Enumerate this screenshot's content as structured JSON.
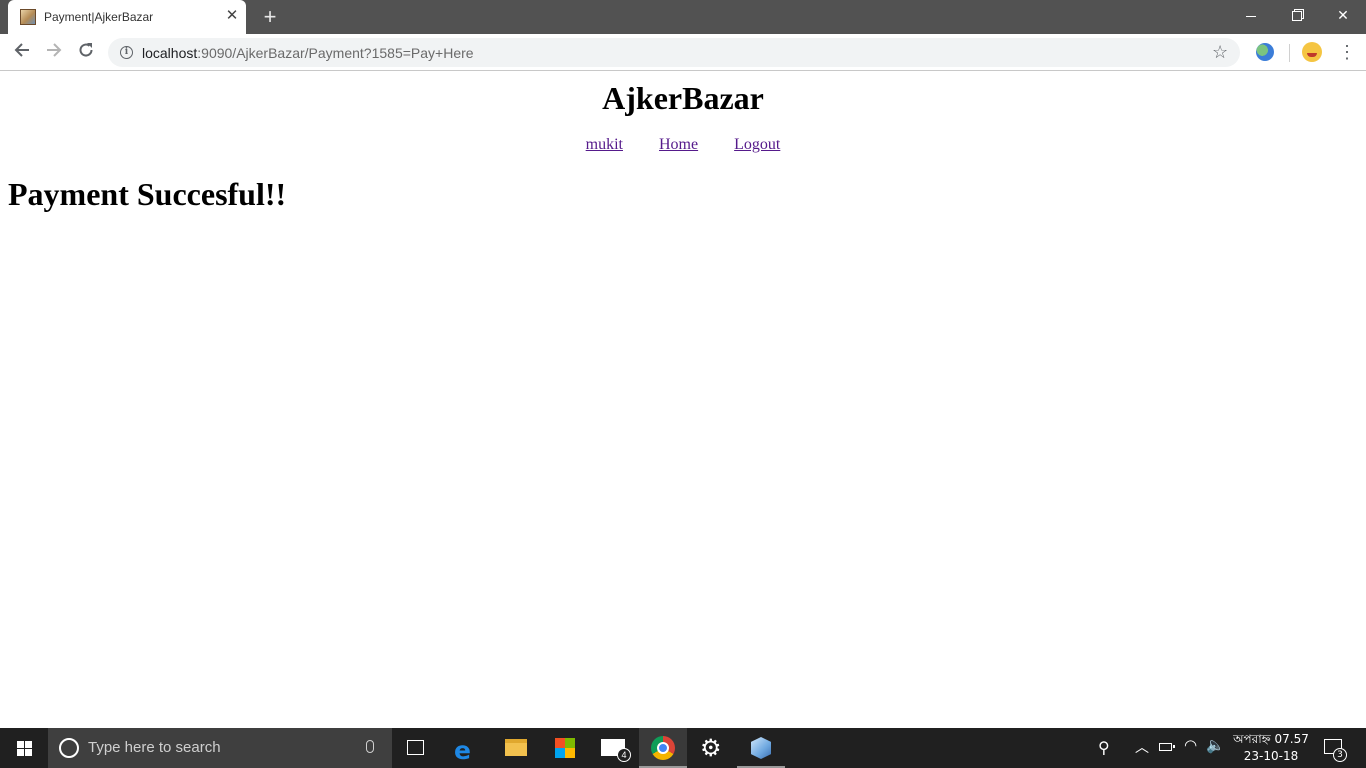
{
  "browser": {
    "tab_title": "Payment|AjkerBazar",
    "tab_close": "✕",
    "new_tab": "+",
    "url_host": "localhost",
    "url_rest": ":9090/AjkerBazar/Payment?1585=Pay+Here",
    "icons": [
      "favicon",
      "close-icon",
      "plus-icon",
      "back-icon",
      "forward-icon",
      "reload-icon",
      "info-icon",
      "star-icon",
      "extension-globe-icon",
      "avatar",
      "menu-icon"
    ]
  },
  "window_controls": {
    "close": "✕"
  },
  "page": {
    "site_title": "AjkerBazar",
    "nav": {
      "user": "mukit",
      "home": "Home",
      "logout": "Logout"
    },
    "message": "Payment Succesful!!"
  },
  "taskbar": {
    "search_placeholder": "Type here to search",
    "mail_badge": "4",
    "clock_time": "অপরাহ্ন 07.57",
    "clock_date": "23-10-18",
    "notification_badge": "3",
    "icons": [
      "windows-start-icon",
      "cortana-icon",
      "mic-icon",
      "task-view-icon",
      "edge-icon",
      "file-explorer-icon",
      "store-icon",
      "mail-icon",
      "chrome-icon",
      "settings-icon",
      "app-cube-icon",
      "people-icon",
      "chevron-up-icon",
      "battery-icon",
      "wifi-icon",
      "volume-icon",
      "action-center-icon"
    ]
  }
}
